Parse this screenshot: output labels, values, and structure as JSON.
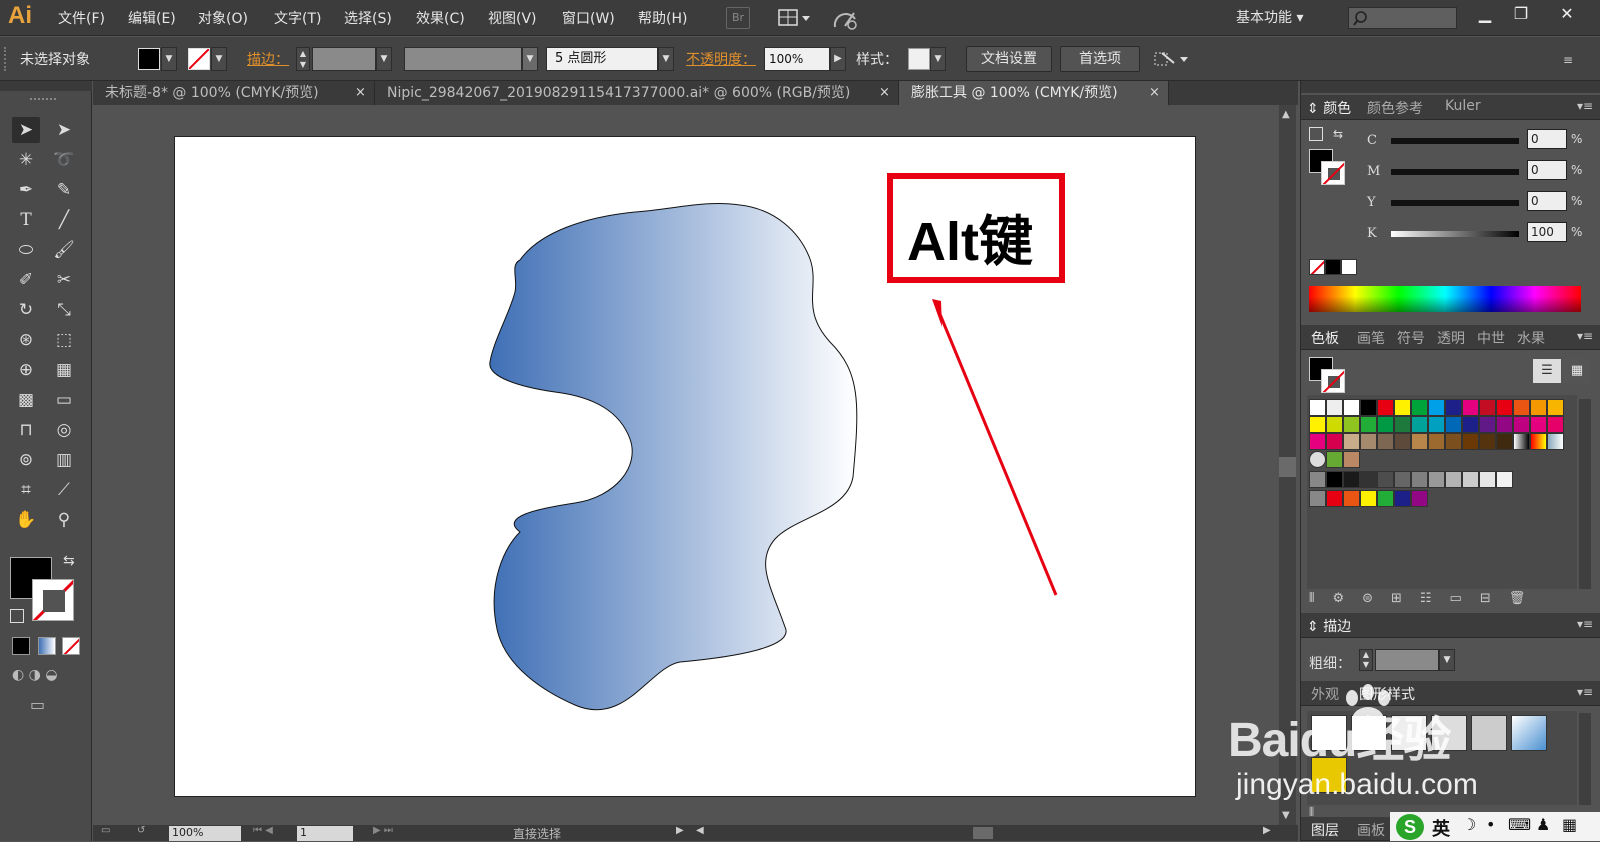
{
  "app": {
    "logo": "Ai"
  },
  "menu": [
    "文件(F)",
    "编辑(E)",
    "对象(O)",
    "文字(T)",
    "选择(S)",
    "效果(C)",
    "视图(V)",
    "窗口(W)",
    "帮助(H)"
  ],
  "menubar": {
    "bridge": "Br",
    "workspace": "基本功能"
  },
  "control": {
    "selection_status": "未选择对象",
    "stroke_label": "描边：",
    "brush_value": "5 点圆形",
    "opacity_label": "不透明度：",
    "opacity_value": "100%",
    "style_label": "样式：",
    "doc_setup": "文档设置",
    "preferences": "首选项"
  },
  "tabs": [
    {
      "label": "未标题-8* @ 100% (CMYK/预览)",
      "close": "×"
    },
    {
      "label": "Nipic_29842067_20190829115417377000.ai* @ 600% (RGB/预览)",
      "close": "×"
    },
    {
      "label": "膨胀工具 @ 100% (CMYK/预览)",
      "close": "×"
    }
  ],
  "canvas": {
    "annotation_text": "Alt键",
    "annotation_border_color": "#e60012",
    "arrow_color": "#e60012",
    "shape_gradient": [
      "#3f6fb5",
      "#ffffff"
    ]
  },
  "color_panel": {
    "tabs": [
      "颜色",
      "颜色参考",
      "Kuler"
    ],
    "channels": [
      {
        "label": "C",
        "value": "0",
        "unit": "%"
      },
      {
        "label": "M",
        "value": "0",
        "unit": "%"
      },
      {
        "label": "Y",
        "value": "0",
        "unit": "%"
      },
      {
        "label": "K",
        "value": "100",
        "unit": "%"
      }
    ]
  },
  "swatches_panel": {
    "tabs": [
      "色板",
      "画笔",
      "符号",
      "透明",
      "中世",
      "水果"
    ]
  },
  "stroke_panel": {
    "title": "描边",
    "weight_label": "粗细："
  },
  "graphic_styles_panel": {
    "tabs": [
      "外观",
      "图形样式"
    ]
  },
  "bottom_panel": {
    "tabs": [
      "图层",
      "画板"
    ]
  },
  "status": {
    "zoom": "100%",
    "page": "1",
    "tool_status": "直接选择"
  },
  "watermark": {
    "line1": "Bai",
    "paw": "du",
    "cn": "经验",
    "line2": "jingyan.baidu.com"
  },
  "ime": {
    "logo": "S",
    "lang": "英"
  }
}
